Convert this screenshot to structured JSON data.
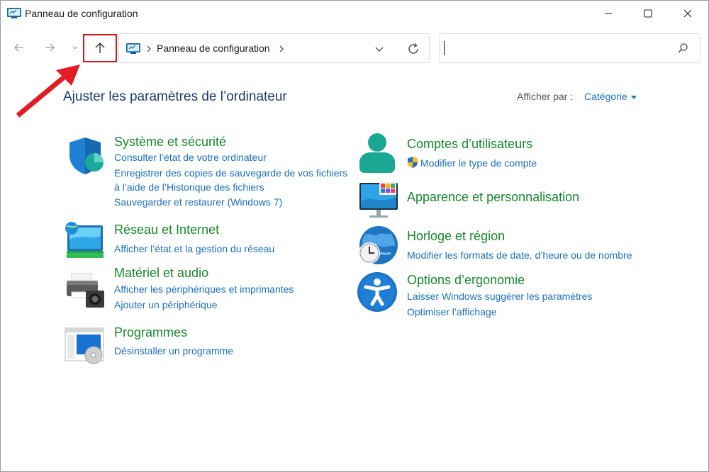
{
  "window": {
    "title": "Panneau de configuration",
    "controls": {
      "minimize": "minimize-icon",
      "maximize": "maximize-icon",
      "close": "close-icon"
    }
  },
  "navbar": {
    "back_icon": "arrow-left-icon",
    "forward_icon": "arrow-right-icon",
    "recent_icon": "chevron-down-icon",
    "up_icon": "arrow-up-icon",
    "address": {
      "crumb": "Panneau de configuration"
    },
    "search": {
      "value": "",
      "placeholder": ""
    }
  },
  "header": {
    "title": "Ajuster les paramètres de l’ordinateur",
    "view_by_label": "Afficher par :",
    "view_by_value": "Catégorie"
  },
  "categories_left": [
    {
      "title": "Système et sécurité",
      "icon": "shield-icon",
      "links": [
        "Consulter l’état de votre ordinateur",
        "Enregistrer des copies de sauvegarde de vos fichiers",
        "à l’aide de l’Historique des fichiers",
        "Sauvegarder et restaurer (Windows 7)"
      ]
    },
    {
      "title": "Réseau et Internet",
      "icon": "network-globe-icon",
      "links": [
        "Afficher l’état et la gestion du réseau"
      ]
    },
    {
      "title": "Matériel et audio",
      "icon": "printer-icon",
      "links": [
        "Afficher les périphériques et imprimantes",
        "Ajouter un périphérique"
      ]
    },
    {
      "title": "Programmes",
      "icon": "programs-icon",
      "links": [
        "Désinstaller un programme"
      ]
    }
  ],
  "categories_right": [
    {
      "title": "Comptes d’utilisateurs",
      "icon": "user-icon",
      "links": [
        "Modifier le type de compte"
      ]
    },
    {
      "title": "Apparence et personnalisation",
      "icon": "monitor-icon",
      "links": []
    },
    {
      "title": "Horloge et région",
      "icon": "globe-clock-icon",
      "links": [
        "Modifier les formats de date, d’heure ou de nombre"
      ]
    },
    {
      "title": "Options d’ergonomie",
      "icon": "accessibility-icon",
      "links": [
        "Laisser Windows suggérer les paramètres",
        "Optimiser l’affichage"
      ]
    }
  ],
  "colors": {
    "category_title": "#138a2a",
    "link": "#1a6fbf",
    "page_title": "#1d3a6b",
    "annotation_red": "#e31b23"
  }
}
